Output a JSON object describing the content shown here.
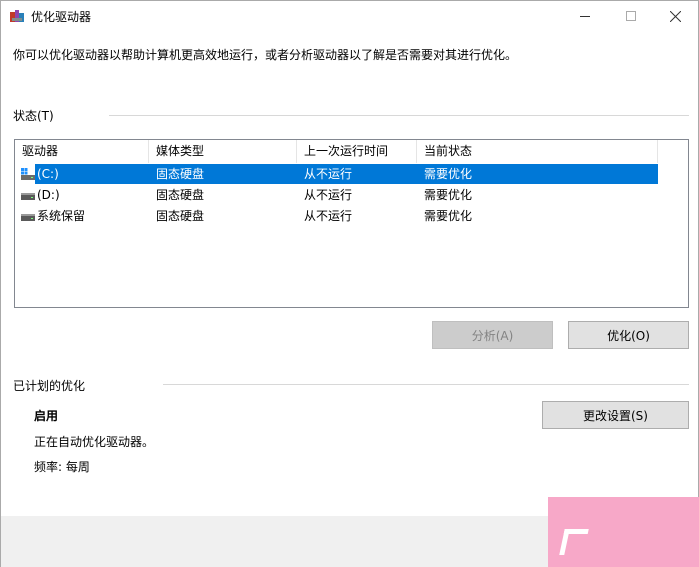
{
  "window": {
    "title": "优化驱动器",
    "icon": "defrag-app-icon"
  },
  "description": "你可以优化驱动器以帮助计算机更高效地运行，或者分析驱动器以了解是否需要对其进行优化。",
  "status_section": {
    "label": "状态(T)"
  },
  "drive_list": {
    "columns": [
      "驱动器",
      "媒体类型",
      "上一次运行时间",
      "当前状态"
    ],
    "rows": [
      {
        "drive": "(C:)",
        "media": "固态硬盘",
        "last_run": "从不运行",
        "status": "需要优化",
        "icon": "windows-drive-icon",
        "selected": true
      },
      {
        "drive": "(D:)",
        "media": "固态硬盘",
        "last_run": "从不运行",
        "status": "需要优化",
        "icon": "drive-icon",
        "selected": false
      },
      {
        "drive": "系统保留",
        "media": "固态硬盘",
        "last_run": "从不运行",
        "status": "需要优化",
        "icon": "drive-icon",
        "selected": false
      }
    ]
  },
  "buttons": {
    "analyze": "分析(A)",
    "optimize": "优化(O)",
    "change_settings": "更改设置(S)"
  },
  "scheduled_section": {
    "label": "已计划的优化",
    "status": "启用",
    "line1": "正在自动优化驱动器。",
    "line2": "频率: 每周"
  },
  "colors": {
    "selection": "#0078d7",
    "button_bg": "#e1e1e1",
    "footer_bg": "#f0f0f0"
  }
}
